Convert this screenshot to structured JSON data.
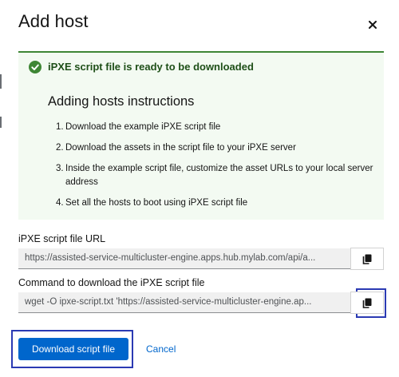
{
  "modal": {
    "title": "Add host",
    "close_icon": "close-icon"
  },
  "alert": {
    "status_icon": "check-circle-icon",
    "status_color": "#3e8635",
    "title": "iPXE script file is ready to be downloaded",
    "instructions_title": "Adding hosts instructions",
    "steps": [
      {
        "num": "1.",
        "text": "Download the example iPXE script file"
      },
      {
        "num": "2.",
        "text": "Download the assets in the script file to your iPXE server"
      },
      {
        "num": "3.",
        "text": "Inside the example script file, customize the asset URLs to your local server address"
      },
      {
        "num": "4.",
        "text": "Set all the hosts to boot using iPXE script file"
      }
    ]
  },
  "script_url": {
    "label": "iPXE script file URL",
    "value": "https://assisted-service-multicluster-engine.apps.hub.mylab.com/api/a...",
    "copy_icon": "copy-icon"
  },
  "command": {
    "label": "Command to download the iPXE script file",
    "value": "wget -O ipxe-script.txt 'https://assisted-service-multicluster-engine.ap...",
    "copy_icon": "copy-icon"
  },
  "footer": {
    "download_label": "Download script file",
    "cancel_label": "Cancel"
  },
  "colors": {
    "primary": "#0066cc",
    "alert_background": "#f3faf2",
    "focus": "#2b3ab3"
  }
}
